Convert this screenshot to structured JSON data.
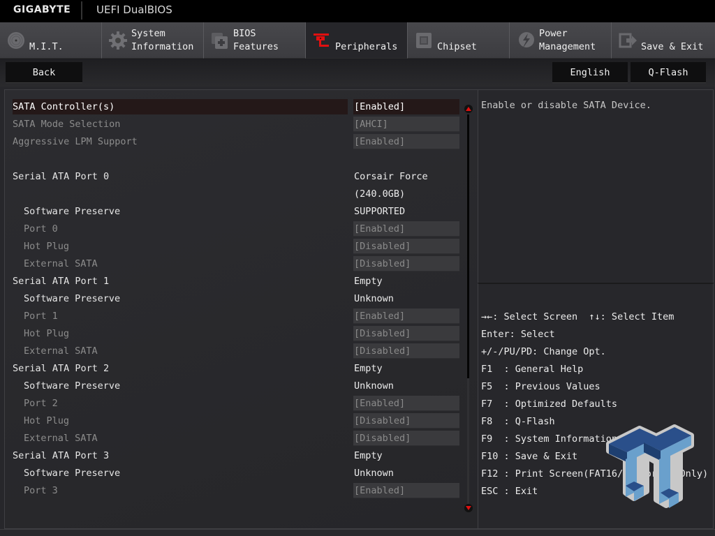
{
  "header": {
    "brand": "GIGABYTE",
    "product": "UEFI DualBIOS"
  },
  "tabs": [
    {
      "line1": "",
      "line2": "M.I.T.",
      "icon": "disc-icon",
      "active": false
    },
    {
      "line1": "System",
      "line2": "Information",
      "icon": "gear-icon",
      "active": false
    },
    {
      "line1": "BIOS",
      "line2": "Features",
      "icon": "chip-plus-icon",
      "active": false
    },
    {
      "line1": "",
      "line2": "Peripherals",
      "icon": "connector-icon",
      "active": true
    },
    {
      "line1": "",
      "line2": "Chipset",
      "icon": "chipset-icon",
      "active": false
    },
    {
      "line1": "Power",
      "line2": "Management",
      "icon": "power-bolt-icon",
      "active": false
    },
    {
      "line1": "",
      "line2": "Save & Exit",
      "icon": "exit-arrow-icon",
      "active": false
    }
  ],
  "toolbar": {
    "back": "Back",
    "language": "English",
    "qflash": "Q-Flash"
  },
  "settings": [
    {
      "name": "SATA Controller(s)",
      "value": "[Enabled]",
      "state": "selected",
      "indent": false
    },
    {
      "name": "SATA Mode Selection",
      "value": "[AHCI]",
      "state": "disabled",
      "indent": false
    },
    {
      "name": "Aggressive LPM Support",
      "value": "[Enabled]",
      "state": "disabled",
      "indent": false
    },
    {
      "name": "",
      "value": "",
      "state": "spacer",
      "indent": false
    },
    {
      "name": "Serial ATA Port 0",
      "value": "Corsair Force",
      "state": "info",
      "indent": false
    },
    {
      "name": "",
      "value": "(240.0GB)",
      "state": "info",
      "indent": false
    },
    {
      "name": "Software Preserve",
      "value": "SUPPORTED",
      "state": "info",
      "indent": true
    },
    {
      "name": "Port 0",
      "value": "[Enabled]",
      "state": "disabled",
      "indent": true
    },
    {
      "name": "Hot Plug",
      "value": "[Disabled]",
      "state": "disabled",
      "indent": true
    },
    {
      "name": "External SATA",
      "value": "[Disabled]",
      "state": "disabled",
      "indent": true
    },
    {
      "name": "Serial ATA Port 1",
      "value": "Empty",
      "state": "info",
      "indent": false
    },
    {
      "name": "Software Preserve",
      "value": "Unknown",
      "state": "info",
      "indent": true
    },
    {
      "name": "Port 1",
      "value": "[Enabled]",
      "state": "disabled",
      "indent": true
    },
    {
      "name": "Hot Plug",
      "value": "[Disabled]",
      "state": "disabled",
      "indent": true
    },
    {
      "name": "External SATA",
      "value": "[Disabled]",
      "state": "disabled",
      "indent": true
    },
    {
      "name": "Serial ATA Port 2",
      "value": "Empty",
      "state": "info",
      "indent": false
    },
    {
      "name": "Software Preserve",
      "value": "Unknown",
      "state": "info",
      "indent": true
    },
    {
      "name": "Port 2",
      "value": "[Enabled]",
      "state": "disabled",
      "indent": true
    },
    {
      "name": "Hot Plug",
      "value": "[Disabled]",
      "state": "disabled",
      "indent": true
    },
    {
      "name": "External SATA",
      "value": "[Disabled]",
      "state": "disabled",
      "indent": true
    },
    {
      "name": "Serial ATA Port 3",
      "value": "Empty",
      "state": "info",
      "indent": false
    },
    {
      "name": "Software Preserve",
      "value": "Unknown",
      "state": "info",
      "indent": true
    },
    {
      "name": "Port 3",
      "value": "[Enabled]",
      "state": "disabled",
      "indent": true
    }
  ],
  "help": {
    "description": "Enable or disable SATA Device."
  },
  "keys": [
    "→←: Select Screen  ↑↓: Select Item",
    "Enter: Select",
    "+/-/PU/PD: Change Opt.",
    "F1  : General Help",
    "F5  : Previous Values",
    "F7  : Optimized Defaults",
    "F8  : Q-Flash",
    "F9  : System Information",
    "F10 : Save & Exit",
    "F12 : Print Screen(FAT16/32 Format Only)",
    "ESC : Exit"
  ],
  "scrollbar": {
    "visible_fraction": 0.67,
    "position": 0
  },
  "colors": {
    "accent": "#e01010",
    "selected_row": "#241818",
    "watermark_light": "#6aa0cc",
    "watermark_dark": "#1e3f70"
  }
}
